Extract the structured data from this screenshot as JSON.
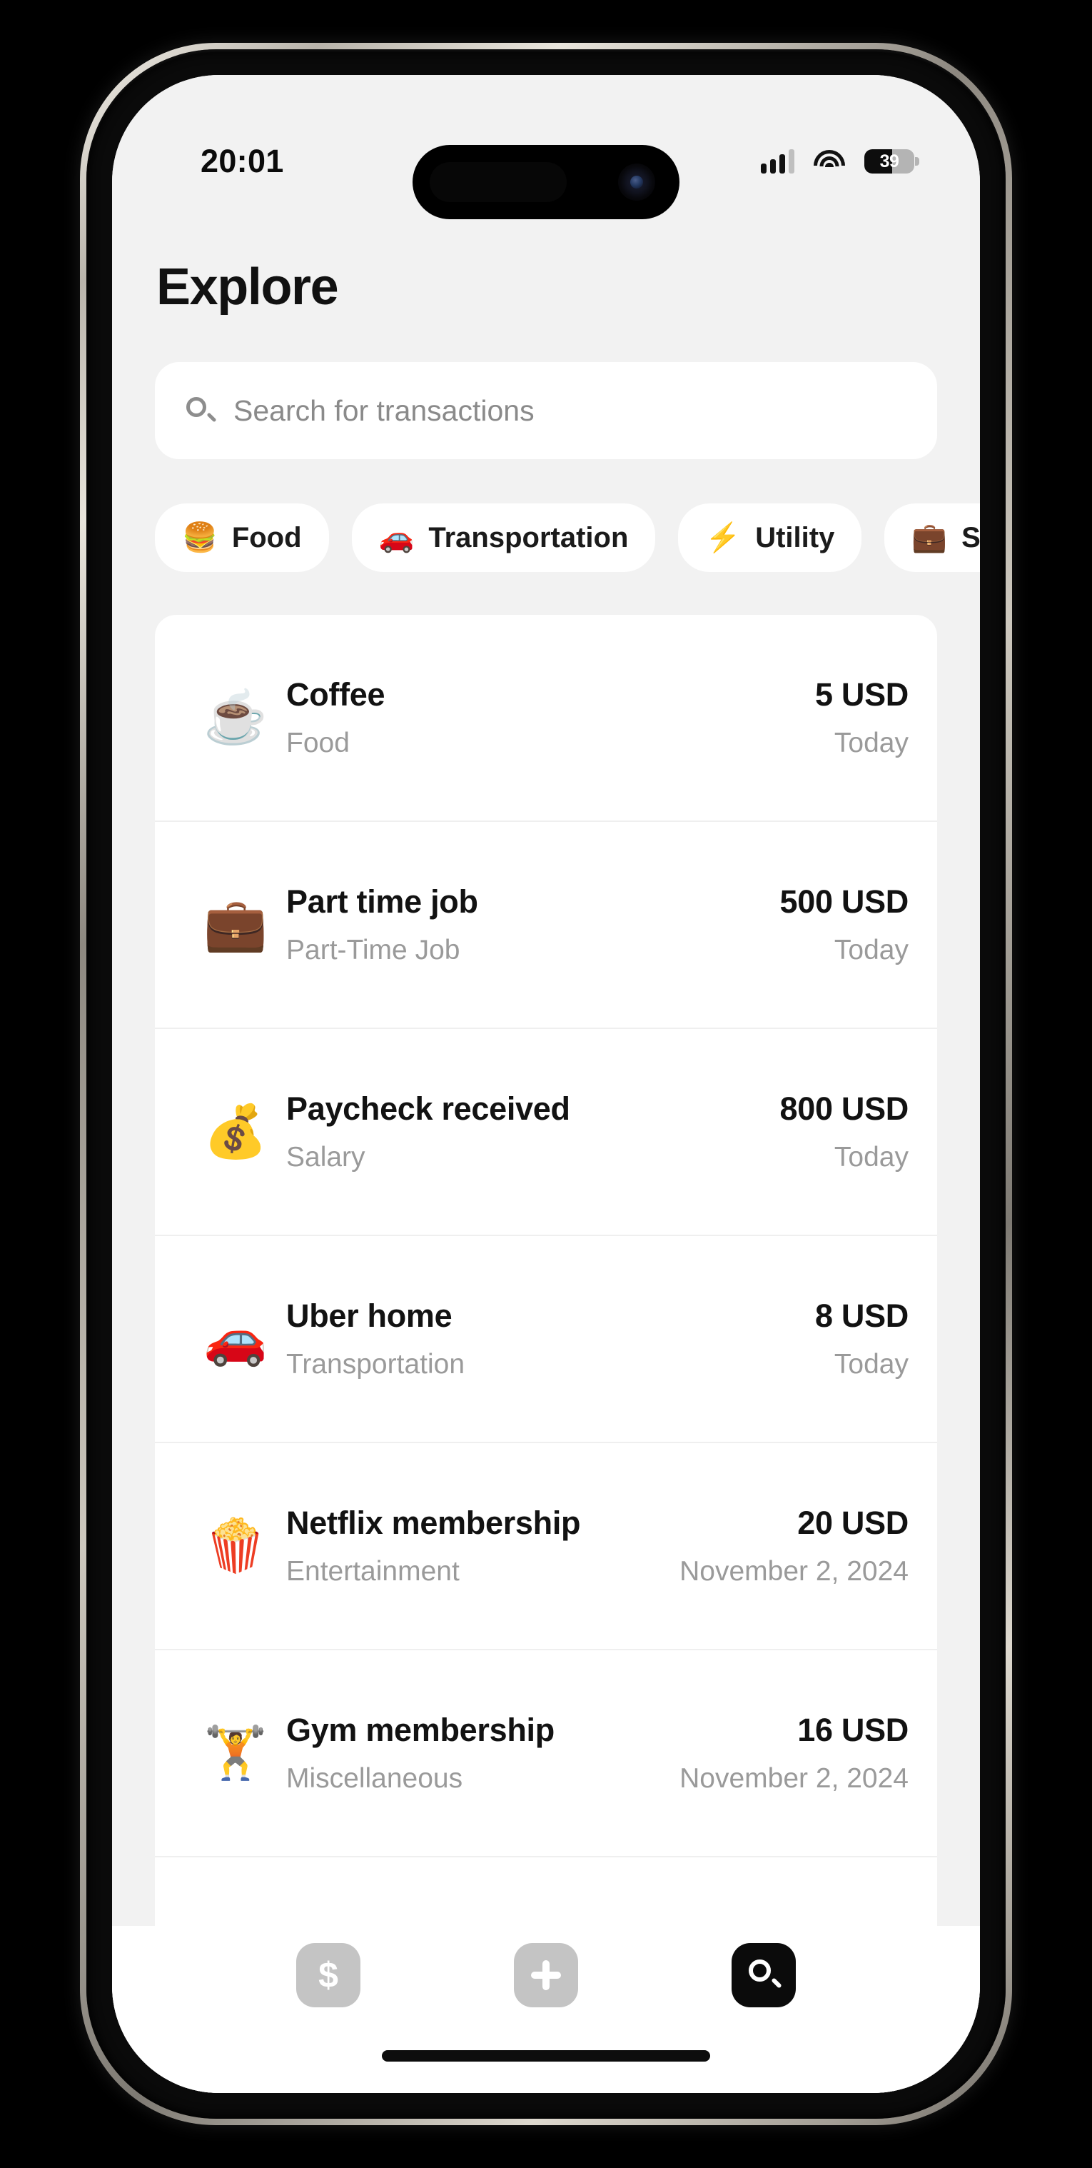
{
  "statusbar": {
    "time": "20:01",
    "signal_icon": "cellular-signal-icon",
    "wifi_icon": "wifi-icon",
    "battery_icon": "battery-icon",
    "battery_percent": "39"
  },
  "header": {
    "title": "Explore"
  },
  "search": {
    "icon": "search-icon",
    "placeholder": "Search for transactions",
    "value": ""
  },
  "chips": [
    {
      "emoji": "🍔",
      "icon": "hamburger-icon",
      "label": "Food"
    },
    {
      "emoji": "🚗",
      "icon": "car-icon",
      "label": "Transportation"
    },
    {
      "emoji": "⚡",
      "icon": "lightning-icon",
      "label": "Utility"
    },
    {
      "emoji": "💼",
      "icon": "briefcase-icon",
      "label": "Salary"
    }
  ],
  "transactions": [
    {
      "emoji": "☕",
      "icon": "coffee-icon",
      "name": "Coffee",
      "category": "Food",
      "amount": "5 USD",
      "date": "Today"
    },
    {
      "emoji": "💼",
      "icon": "briefcase-icon",
      "name": "Part time job",
      "category": "Part-Time Job",
      "amount": "500 USD",
      "date": "Today"
    },
    {
      "emoji": "💰",
      "icon": "money-bag-icon",
      "name": "Paycheck received",
      "category": "Salary",
      "amount": "800 USD",
      "date": "Today"
    },
    {
      "emoji": "🚗",
      "icon": "car-icon",
      "name": "Uber home",
      "category": "Transportation",
      "amount": "8 USD",
      "date": "Today"
    },
    {
      "emoji": "🍿",
      "icon": "popcorn-icon",
      "name": "Netflix membership",
      "category": "Entertainment",
      "amount": "20 USD",
      "date": "November 2, 2024"
    },
    {
      "emoji": "🏋️",
      "icon": "weightlifter-icon",
      "name": "Gym membership",
      "category": "Miscellaneous",
      "amount": "16 USD",
      "date": "November 2, 2024"
    }
  ],
  "tabbar": [
    {
      "icon": "dollar-icon",
      "label": "$",
      "active": false
    },
    {
      "icon": "plus-icon",
      "label": "+",
      "active": false
    },
    {
      "icon": "search-icon",
      "label": "",
      "active": true
    }
  ],
  "colors": {
    "screen_bg": "#f2f2f2",
    "card_bg": "#ffffff",
    "primary_text": "#121212",
    "secondary_text": "#9a9a9a",
    "tab_inactive": "#c4c4c4",
    "tab_active": "#0b0b0b"
  }
}
